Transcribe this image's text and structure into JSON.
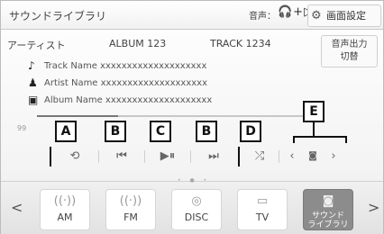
{
  "header": {
    "title": "サウンドライブラリ",
    "audio_label": "音声：",
    "audio_icons": "🎧+▷",
    "settings_label": "画面設定",
    "settings_icon": "gear-icon"
  },
  "info": {
    "artist_label": "アーティスト",
    "album": "ALBUM 123",
    "track": "TRACK 1234",
    "output_button": [
      "音声出力",
      "切替"
    ]
  },
  "meta": {
    "track_name": "Track Name xxxxxxxxxxxxxxxxxxxx",
    "artist_name": "Artist Name xxxxxxxxxxxxxxxxxxxx",
    "album_name": "Album Name xxxxxxxxxxxxxxxxxxxx"
  },
  "playback": {
    "time": "99",
    "progress_fraction": 0.3
  },
  "callouts": {
    "A": "A",
    "B1": "B",
    "C": "C",
    "B2": "B",
    "D": "D",
    "E": "E"
  },
  "controls": {
    "repeat": "⟲",
    "prev": "⏮",
    "play_pause": "▶⏸",
    "next": "⏭",
    "shuffle": "⤮",
    "left": "‹",
    "center": "◙",
    "right": "›"
  },
  "sources": [
    {
      "label": "AM",
      "icon": "radio-waves-icon"
    },
    {
      "label": "FM",
      "icon": "radio-waves-icon"
    },
    {
      "label": "DISC",
      "icon": "disc-icon"
    },
    {
      "label": "TV",
      "icon": "tv-icon"
    },
    {
      "label": "サウンド\nライブラリ",
      "icon": "sound-library-icon",
      "active": true
    }
  ],
  "source_nav": {
    "left": "<",
    "right": ">"
  }
}
